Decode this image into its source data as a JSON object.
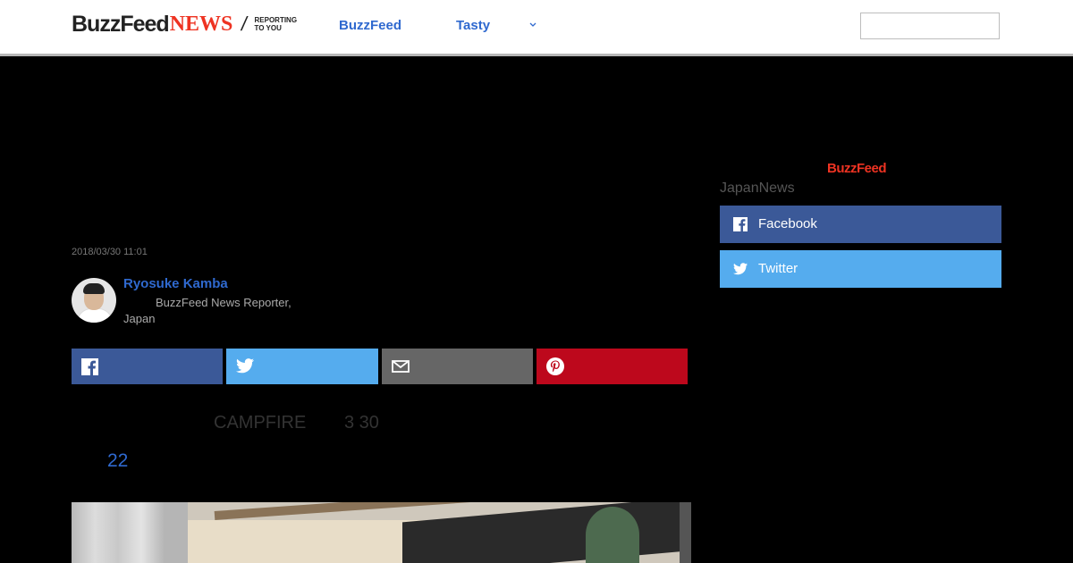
{
  "header": {
    "logo": {
      "buzzfeed": "BuzzFeed",
      "news": "NEWS",
      "tagline_line1": "REPORTING",
      "tagline_line2": "TO YOU"
    },
    "nav": [
      {
        "label": "BuzzFeed"
      },
      {
        "label": "Tasty"
      }
    ],
    "search": {
      "placeholder": ""
    }
  },
  "article": {
    "date": "2018/03/30 11:01",
    "author": {
      "name": "Ryosuke Kamba",
      "title_line1": "BuzzFeed News Reporter,",
      "title_line2": "Japan"
    },
    "share_buttons": [
      {
        "network": "facebook",
        "icon": "facebook-icon",
        "color": "#3b5998"
      },
      {
        "network": "twitter",
        "icon": "twitter-icon",
        "color": "#55acee"
      },
      {
        "network": "email",
        "icon": "email-icon",
        "color": "#666666"
      },
      {
        "network": "pinterest",
        "icon": "pinterest-icon",
        "color": "#bd081c"
      }
    ],
    "body_text_1": "CAMPFIRE",
    "body_text_2": "3 30",
    "body_link": "22"
  },
  "sidebar": {
    "logo": "BuzzFeed",
    "label": "JapanNews",
    "buttons": [
      {
        "label": "Facebook",
        "color": "#3b5998"
      },
      {
        "label": "Twitter",
        "color": "#55acee"
      }
    ]
  },
  "colors": {
    "link": "#2f69cf",
    "brand_red": "#ee3322",
    "background": "#000000"
  }
}
